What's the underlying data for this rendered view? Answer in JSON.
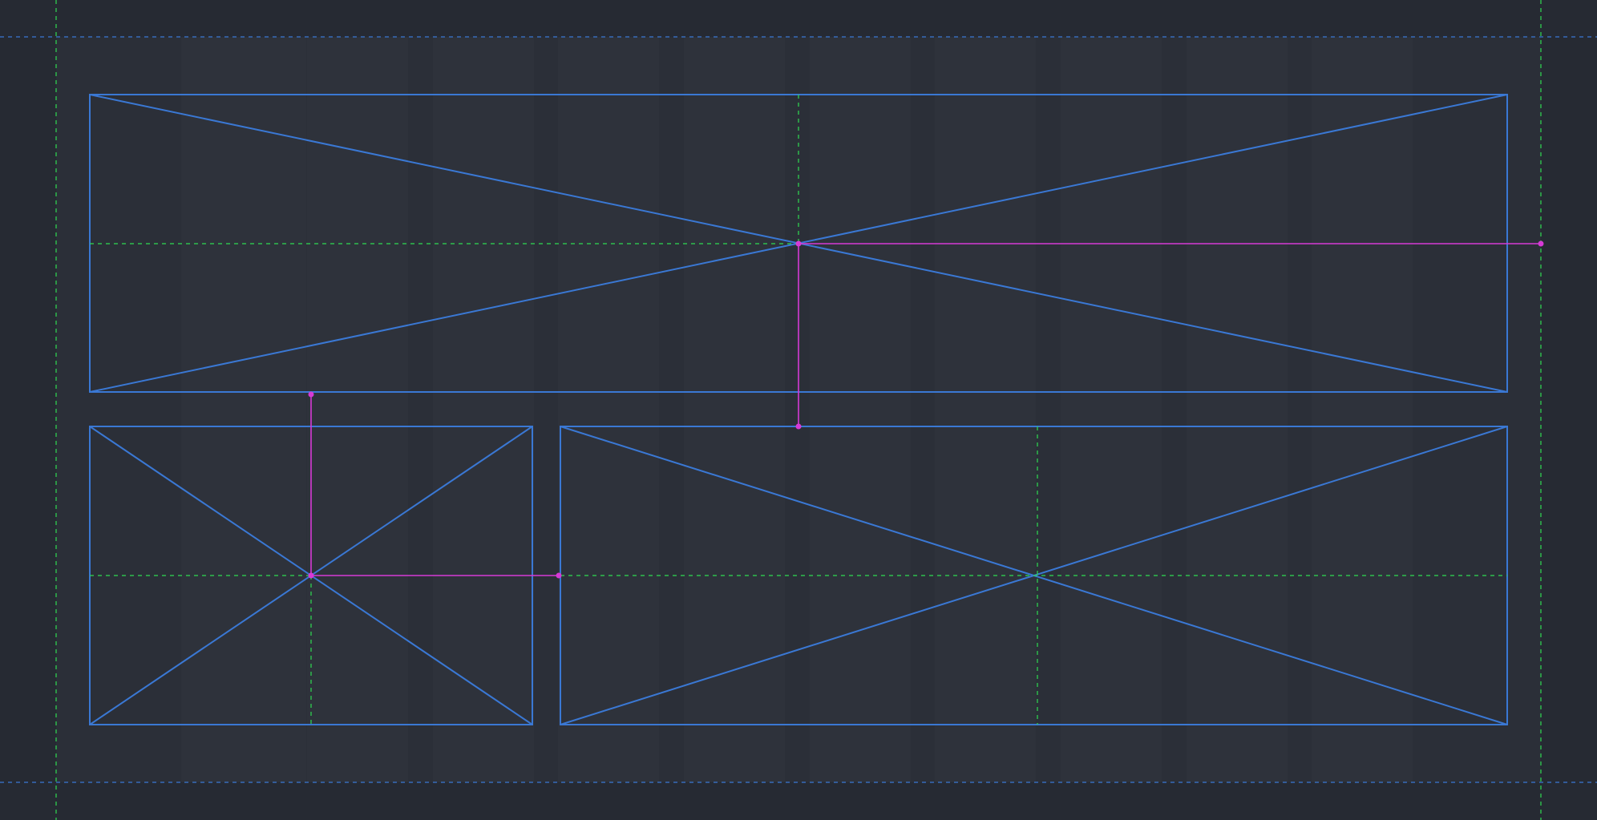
{
  "colors": {
    "background": "#262a33",
    "page_area": "#2b2f38",
    "grid_column": "#2e323b",
    "frame_stroke": "#3a78d4",
    "center_guide": "#2fdc52",
    "margin_guide": "#2fdc52",
    "baseline_guide": "#3a78d4",
    "measure": "#d63ad6"
  },
  "frames": [
    {
      "id": "frame-top",
      "kind": "image-placeholder"
    },
    {
      "id": "frame-bottom-left",
      "kind": "image-placeholder"
    },
    {
      "id": "frame-bottom-right",
      "kind": "image-placeholder"
    }
  ],
  "grid": {
    "columns": 12,
    "gutter_shade": true
  },
  "measurements": [
    {
      "id": "measure-top-center-to-right-margin"
    },
    {
      "id": "measure-top-center-to-bottom-right-frame"
    },
    {
      "id": "measure-left-center-to-top-frame"
    },
    {
      "id": "measure-left-center-to-right-frame"
    }
  ]
}
